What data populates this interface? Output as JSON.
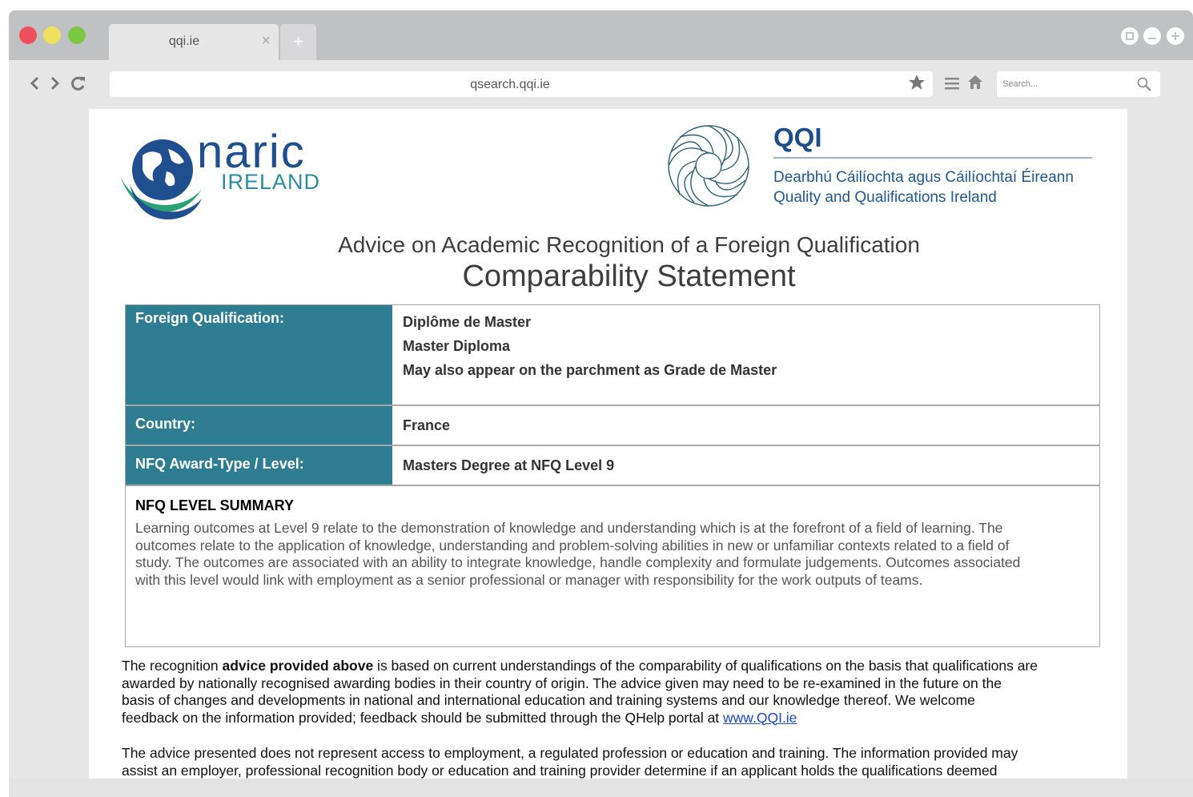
{
  "browser": {
    "tab_title": "qqi.ie",
    "tab_close": "×",
    "new_tab": "+",
    "url": "qsearch.qqi.ie",
    "search_placeholder": "Search..."
  },
  "logos": {
    "naric_word": "naric",
    "naric_sub": "IRELAND",
    "qqi_word": "QQI",
    "qqi_irish": "Dearbhú Cáilíochta agus Cáilíochtaí Éireann",
    "qqi_english": "Quality and Qualifications Ireland"
  },
  "document": {
    "heading": "Advice on Academic Recognition of a Foreign Qualification",
    "title": "Comparability Statement",
    "rows": [
      {
        "label": "Foreign Qualification:",
        "values": [
          "Diplôme de Master",
          "Master Diploma",
          "May also appear on the parchment as Grade de Master"
        ]
      },
      {
        "label": "Country:",
        "values": [
          "France"
        ]
      },
      {
        "label": "NFQ Award-Type / Level:",
        "values": [
          "Masters Degree at NFQ Level 9"
        ]
      }
    ],
    "summary_title": "NFQ LEVEL SUMMARY",
    "summary_lines": [
      "Learning outcomes at Level 9 relate to the demonstration of knowledge and understanding which is at the forefront of a field of learning. The",
      "outcomes relate to the application of knowledge, understanding and problem-solving abilities in new or unfamiliar contexts related to a field of",
      "study. The outcomes are associated with an ability to integrate knowledge, handle complexity and formulate judgements. Outcomes associated",
      "with this level would link with employment as a senior professional or manager with responsibility for the work outputs of teams."
    ],
    "para1_pre": "The recognition ",
    "para1_bold": "advice provided above",
    "para1_line1_rest": " is based on current understandings of the comparability of qualifications on the basis that qualifications are",
    "para1_lines": [
      "awarded by nationally recognised awarding bodies in their country of origin. The advice given may need to be re-examined in the future on the",
      "basis of changes and developments in national and international education and training systems and our knowledge thereof. We welcome"
    ],
    "para1_last": "feedback on the information provided; feedback should be submitted through the QHelp portal at ",
    "para1_link": "www.QQI.ie",
    "para2_lines": [
      "The advice presented does not represent access to employment, a regulated profession or education and training. The information provided may",
      "assist an employer, professional recognition body or education and training provider determine if an applicant holds the qualifications deemed"
    ]
  },
  "colors": {
    "label_bg": "#2e7d93",
    "naric_blue": "#1f4f8f",
    "qqi_blue": "#1d5a93",
    "link": "#1a48c9"
  }
}
